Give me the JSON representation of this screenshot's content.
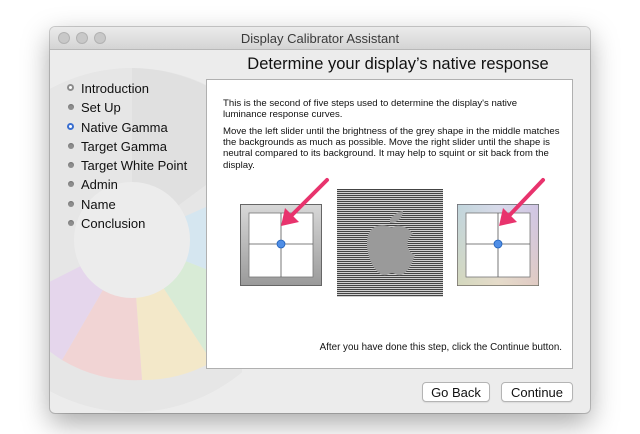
{
  "window": {
    "title": "Display Calibrator Assistant"
  },
  "sidebar": {
    "steps": [
      {
        "label": "Introduction",
        "state": "done"
      },
      {
        "label": "Set Up",
        "state": "pending"
      },
      {
        "label": "Native Gamma",
        "state": "current"
      },
      {
        "label": "Target Gamma",
        "state": "pending"
      },
      {
        "label": "Target White Point",
        "state": "pending"
      },
      {
        "label": "Admin",
        "state": "pending"
      },
      {
        "label": "Name",
        "state": "pending"
      },
      {
        "label": "Conclusion",
        "state": "pending"
      }
    ]
  },
  "main": {
    "heading": "Determine your display’s native response",
    "paragraph1": "This is the second of five steps used to determine the display's native luminance response curves.",
    "paragraph2": "Move the left slider until the brightness of the grey shape in the middle matches the backgrounds as much as possible.  Move the right slider until the shape is neutral compared to its background.  It may help to squint or sit back from the display.",
    "footer_note": "After you have done this step, click the Continue button."
  },
  "buttons": {
    "go_back": "Go Back",
    "continue": "Continue"
  },
  "icons": {
    "window_controls": [
      "close-icon",
      "minimize-icon",
      "zoom-icon"
    ],
    "center_sample": "apple-logo-icon",
    "pointers": [
      "arrow-pointer-icon",
      "arrow-pointer-icon"
    ]
  },
  "colors": {
    "accent": "#3a6fd0",
    "arrow": "#e8336d"
  }
}
